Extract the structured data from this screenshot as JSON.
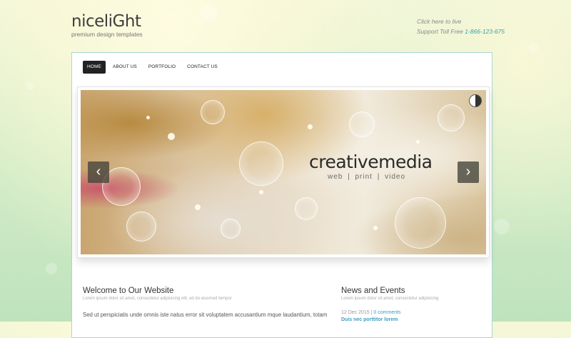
{
  "logo": {
    "title": "niceliGht",
    "tagline": "premium design templates"
  },
  "contact": {
    "line1": "Click here to live",
    "line2_prefix": "Support Toll Free ",
    "phone": "1-866-123-675"
  },
  "nav": {
    "items": [
      {
        "label": "HOME",
        "active": true
      },
      {
        "label": "ABOUT US"
      },
      {
        "label": "PORTFOLIO"
      },
      {
        "label": "CONTACT US"
      }
    ]
  },
  "slider": {
    "title": "creativemedia",
    "subtitle": "web  |  print  |  video",
    "prev_icon": "‹",
    "next_icon": "›"
  },
  "welcome": {
    "title": "Welcome to Our Website",
    "subtitle": "Lorem ipsum dolor sit amet, consectetur adipisicing elit, ed do eiusmod tempor",
    "body": "Sed ut perspiciatis unde omnis iste natus error sit voluptatem accusantium mque laudantium, totam"
  },
  "news": {
    "title": "News and Events",
    "subtitle": "Lorem ipsum dolor sit amet, consectetur adipisicing",
    "date": "12 Dec 2015",
    "separator": " | ",
    "comments": "0 comments",
    "link": "Duis nec porttitor lorem"
  },
  "colors": {
    "accent": "#3aa3a8",
    "panel_border": "#a7d8cf",
    "nav_active": "#222222"
  }
}
